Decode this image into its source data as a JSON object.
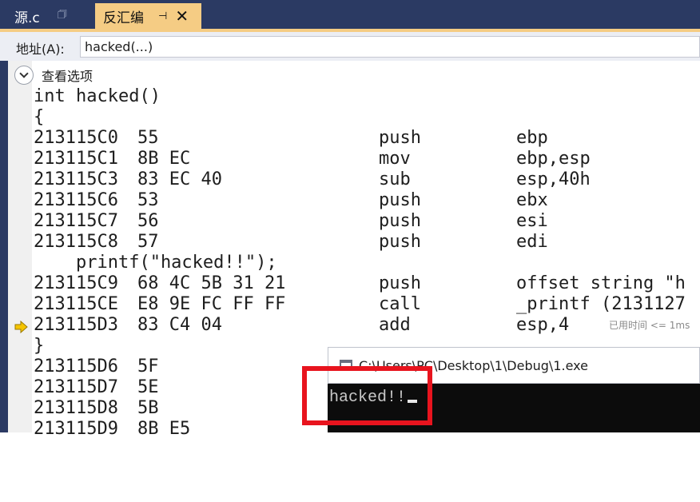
{
  "tabs": [
    {
      "label": "源.c",
      "pin_icon": "pin-icon",
      "active": false
    },
    {
      "label": "反汇编",
      "pin_icon": "pin-icon",
      "close_icon": "close-icon",
      "active": true
    }
  ],
  "address_bar": {
    "label": "地址(A):",
    "value": "hacked(...)"
  },
  "view_options": {
    "label": "查看选项",
    "icon": "chevron-down-icon"
  },
  "code_lines": {
    "fn_sig": "int hacked()",
    "open_brace": "{",
    "l1": {
      "addr": "213115C0",
      "bytes": "55",
      "op": "push",
      "args": "ebp"
    },
    "l2": {
      "addr": "213115C1",
      "bytes": "8B EC",
      "op": "mov",
      "args": "ebp,esp"
    },
    "l3": {
      "addr": "213115C3",
      "bytes": "83 EC 40",
      "op": "sub",
      "args": "esp,40h"
    },
    "l4": {
      "addr": "213115C6",
      "bytes": "53",
      "op": "push",
      "args": "ebx"
    },
    "l5": {
      "addr": "213115C7",
      "bytes": "56",
      "op": "push",
      "args": "esi"
    },
    "l6": {
      "addr": "213115C8",
      "bytes": "57",
      "op": "push",
      "args": "edi"
    },
    "printf_src": "    printf(\"hacked!!\");",
    "l7": {
      "addr": "213115C9",
      "bytes": "68 4C 5B 31 21",
      "op": "push",
      "args": "offset string \"h"
    },
    "l8": {
      "addr": "213115CE",
      "bytes": "E8 9E FC FF FF",
      "op": "call",
      "args": "_printf (2131127"
    },
    "l9": {
      "addr": "213115D3",
      "bytes": "83 C4 04",
      "op": "add",
      "args": "esp,4",
      "elapsed": "已用时间 <= 1ms",
      "current": true
    },
    "close_brace": "}",
    "l10": {
      "addr": "213115D6",
      "bytes": "5F"
    },
    "l11": {
      "addr": "213115D7",
      "bytes": "5E"
    },
    "l12": {
      "addr": "213115D8",
      "bytes": "5B"
    },
    "l13": {
      "addr": "213115D9",
      "bytes": "8B E5"
    }
  },
  "console": {
    "title": "C:\\Users\\PC\\Desktop\\1\\Debug\\1.exe",
    "output": "hacked!!"
  },
  "colors": {
    "tab_bar": "#2b3a63",
    "active_tab": "#f5cc84",
    "highlight_box": "#e8141e",
    "console_bg": "#0c0c0c",
    "arrow": "#f5c400"
  }
}
